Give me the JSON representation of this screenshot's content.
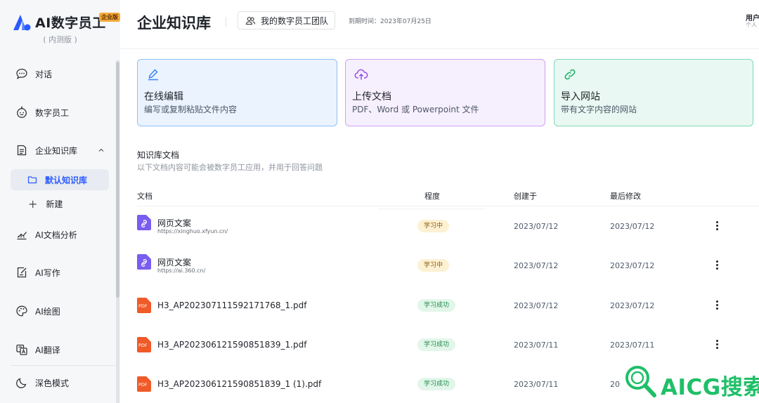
{
  "brand": {
    "name": "AI数字员工",
    "badge": "企业版",
    "subtitle": "( 内测版 )"
  },
  "sidebar": {
    "items": [
      {
        "label": "对话",
        "icon": "chat-bubble-icon"
      },
      {
        "label": "数字员工",
        "icon": "robot-icon"
      },
      {
        "label": "企业知识库",
        "icon": "knowledge-doc-icon"
      },
      {
        "label": "AI文档分析",
        "icon": "chart-icon"
      },
      {
        "label": "AI写作",
        "icon": "edit-icon"
      },
      {
        "label": "AI绘图",
        "icon": "palette-icon"
      },
      {
        "label": "AI翻译",
        "icon": "translate-icon"
      },
      {
        "label": "深色模式",
        "icon": "moon-icon"
      }
    ],
    "kb_children": {
      "active": "默认知识库",
      "new": "新建"
    }
  },
  "header": {
    "title": "企业知识库",
    "team_button": "我的数字员工团队",
    "expire": "到期时间：2023年07月25日",
    "user": "用户",
    "user_sub": "个人"
  },
  "cards": [
    {
      "title": "在线编辑",
      "desc": "编写或复制粘贴文件内容",
      "icon": "pen-icon",
      "color": "#3b82f6"
    },
    {
      "title": "上传文档",
      "desc": "PDF、Word 或 Powerpoint 文件",
      "icon": "cloud-upload-icon",
      "color": "#9b4fe6"
    },
    {
      "title": "导入网站",
      "desc": "带有文字内容的网站",
      "icon": "link-icon",
      "color": "#1fae6f"
    }
  ],
  "section": {
    "title": "知识库文档",
    "desc": "以下文档内容可能会被数字员工应用，并用于回答问题"
  },
  "table": {
    "headers": [
      "文档",
      "程度",
      "创建于",
      "最后修改"
    ],
    "rows": [
      {
        "name": "网页文案",
        "url": "https://xinghuo.xfyun.cn/",
        "type": "web",
        "status": "学习中",
        "created": "2023/07/12",
        "modified": "2023/07/12"
      },
      {
        "name": "网页文案",
        "url": "https://ai.360.cn/",
        "type": "web",
        "status": "学习中",
        "created": "2023/07/12",
        "modified": "2023/07/12"
      },
      {
        "name": "H3_AP202307111592171768_1.pdf",
        "url": "",
        "type": "pdf",
        "status": "学习成功",
        "created": "2023/07/12",
        "modified": "2023/07/12"
      },
      {
        "name": "H3_AP202306121590851839_1.pdf",
        "url": "",
        "type": "pdf",
        "status": "学习成功",
        "created": "2023/07/11",
        "modified": "2023/07/11"
      },
      {
        "name": "H3_AP202306121590851839_1 (1).pdf",
        "url": "",
        "type": "pdf",
        "status": "学习成功",
        "created": "2023/07/11",
        "modified": "20"
      }
    ]
  },
  "pdf_label": "PDF",
  "watermark": {
    "text": "AICG搜索"
  },
  "colors": {
    "accent": "#2b5cff",
    "learning": "#fdf1d3",
    "done": "#e2f6ea",
    "pdf": "#f05a28",
    "web": "#7b5cf0"
  }
}
